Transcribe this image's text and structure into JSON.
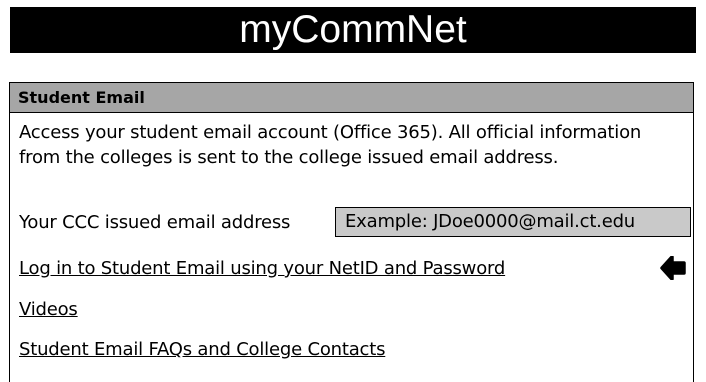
{
  "banner": {
    "title": "myCommNet"
  },
  "panel": {
    "header": "Student Email",
    "description": "Access your student email account (Office 365). All official information from the colleges is sent to the college issued email address.",
    "email_label": "Your CCC issued email address",
    "email_value": "Example:  JDoe0000@mail.ct.edu",
    "links": {
      "login": "Log in to Student Email using your NetID and Password",
      "videos": "Videos",
      "faq": "Student Email FAQs and College Contacts"
    },
    "return_icon": "return-arrow-icon"
  }
}
